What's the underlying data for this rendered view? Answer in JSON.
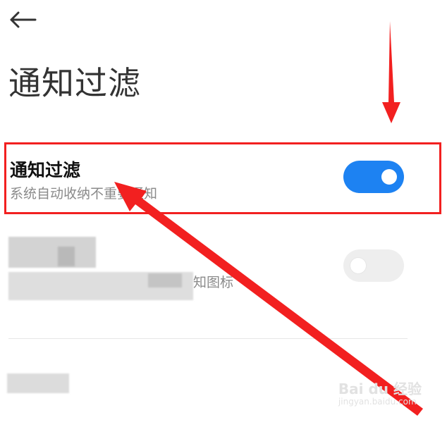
{
  "header": {
    "title": "通知过滤"
  },
  "settings": [
    {
      "title": "通知过滤",
      "subtitle": "系统自动收纳不重要通知",
      "enabled": true
    },
    {
      "title": "",
      "subtitle": "知图标",
      "enabled": false
    },
    {
      "title": "",
      "subtitle": "",
      "enabled": false
    }
  ],
  "colors": {
    "accent": "#1d82f2",
    "annotation": "#f22020",
    "toggle_off": "#eeeeee"
  },
  "icons": {
    "back": "arrow-left-icon"
  },
  "watermark": {
    "line1": "Bai du 经验",
    "line2": "jingyan.baidu.com"
  }
}
